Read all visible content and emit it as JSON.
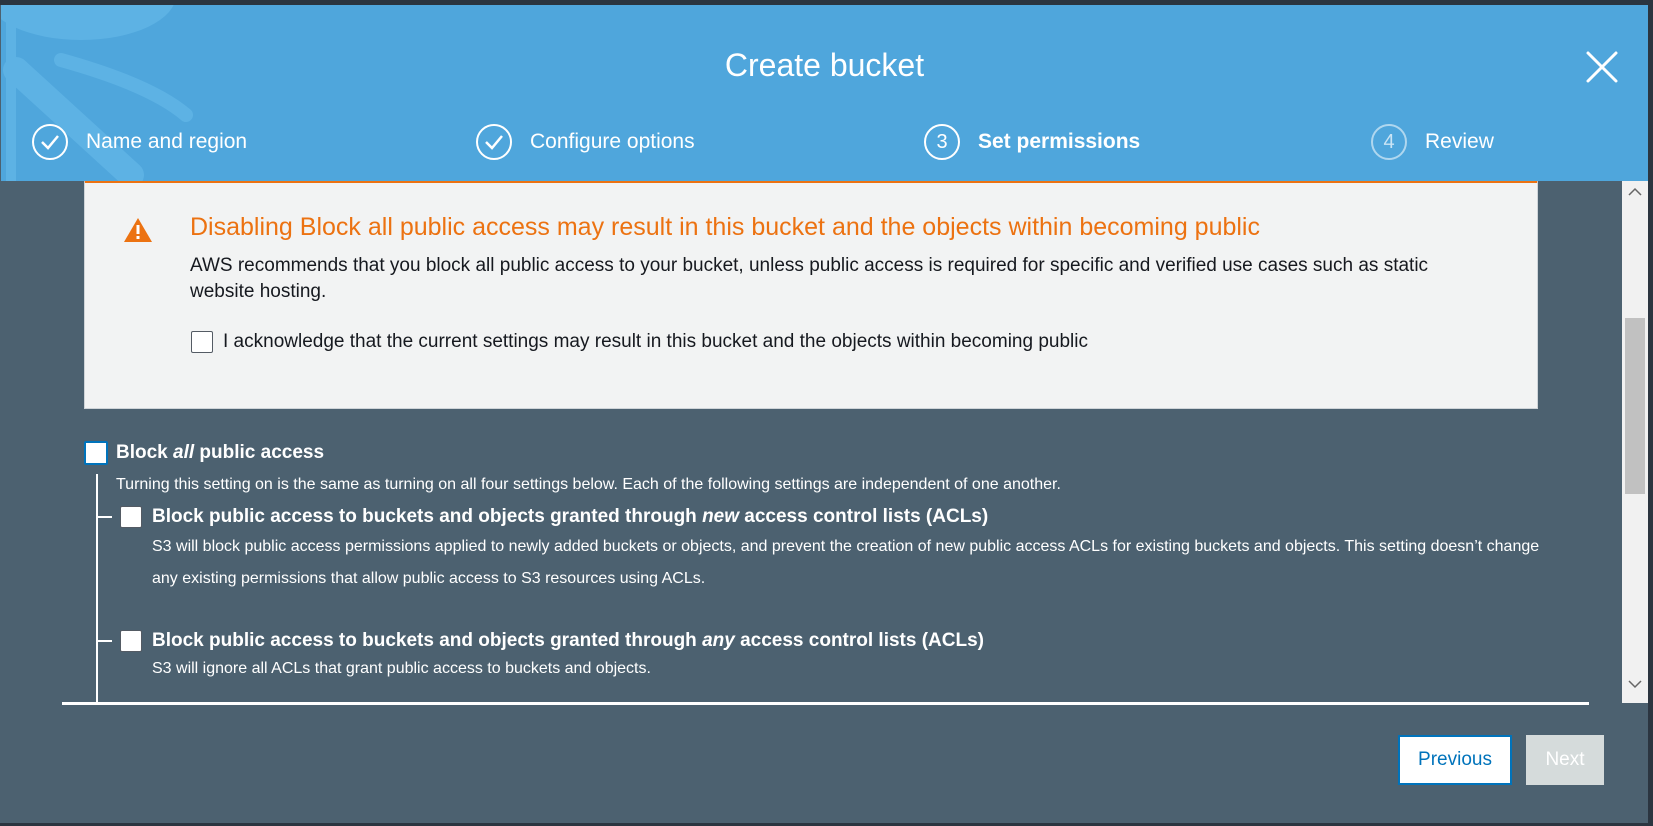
{
  "modal": {
    "title": "Create bucket"
  },
  "steps": [
    {
      "number": "",
      "label": "Name and region",
      "status": "complete"
    },
    {
      "number": "",
      "label": "Configure options",
      "status": "complete"
    },
    {
      "number": "3",
      "label": "Set permissions",
      "status": "current"
    },
    {
      "number": "4",
      "label": "Review",
      "status": "pending"
    }
  ],
  "warning": {
    "title": "Disabling Block all public access may result in this bucket and the objects within becoming public",
    "body": "AWS recommends that you block all public access to your bucket, unless public access is required for specific and verified use cases such as static website hosting.",
    "acknowledge_label": "I acknowledge that the current settings may result in this bucket and the objects within becoming public",
    "acknowledge_checked": false,
    "accent_color": "#ec7211"
  },
  "block_all": {
    "label_pre": "Block ",
    "label_em": "all",
    "label_post": " public access",
    "checked": false,
    "description": "Turning this setting on is the same as turning on all four settings below. Each of the following settings are independent of one another."
  },
  "options": [
    {
      "label_pre": "Block public access to buckets and objects granted through ",
      "label_em": "new",
      "label_post": " access control lists (ACLs)",
      "checked": false,
      "description": "S3 will block public access permissions applied to newly added buckets or objects, and prevent the creation of new public access ACLs for existing buckets and objects. This setting doesn’t change any existing permissions that allow public access to S3 resources using ACLs."
    },
    {
      "label_pre": "Block public access to buckets and objects granted through ",
      "label_em": "any",
      "label_post": " access control lists (ACLs)",
      "checked": false,
      "description": "S3 will ignore all ACLs that grant public access to buckets and objects."
    }
  ],
  "footer": {
    "previous_label": "Previous",
    "next_label": "Next"
  },
  "colors": {
    "header_bg": "#4fa6dc",
    "modal_bg": "#4c6170",
    "link_blue": "#0073bb"
  }
}
